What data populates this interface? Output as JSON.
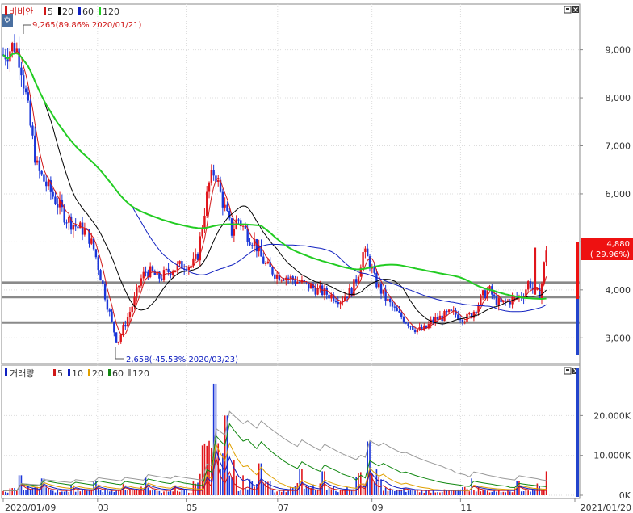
{
  "price_panel": {
    "stock_name": "비비안",
    "ma_legend": [
      {
        "label": "5",
        "color": "#d01818"
      },
      {
        "label": "20",
        "color": "#000000"
      },
      {
        "label": "60",
        "color": "#1020c0"
      },
      {
        "label": "120",
        "color": "#22cc22"
      }
    ],
    "high_annotation": "9,265(89.86% 2020/01/21)",
    "low_annotation": "2,658(-45.53% 2020/03/23)",
    "current_price": "4,880",
    "current_change": "( 29.96%)",
    "side_tab_label": "호"
  },
  "volume_panel": {
    "title": "거래량",
    "ma_legend": [
      {
        "label": "5",
        "color": "#d01818"
      },
      {
        "label": "10",
        "color": "#1020c0"
      },
      {
        "label": "20",
        "color": "#e0a000"
      },
      {
        "label": "60",
        "color": "#118811"
      },
      {
        "label": "120",
        "color": "#999999"
      }
    ]
  },
  "date_labels": [
    {
      "label": "2020/01/09",
      "t": 0
    },
    {
      "label": "03",
      "t": 0.165
    },
    {
      "label": "05",
      "t": 0.32
    },
    {
      "label": "07",
      "t": 0.48
    },
    {
      "label": "09",
      "t": 0.645
    },
    {
      "label": "11",
      "t": 0.8
    },
    {
      "label": "2021/01/20",
      "t": 1
    }
  ],
  "chart_data": [
    {
      "type": "candlestick",
      "title": "비비안",
      "y_ticks": [
        "9,000",
        "8,000",
        "7,000",
        "6,000",
        "5,000",
        "4,000",
        "3,000"
      ],
      "ylim": [
        2500,
        9700
      ],
      "x_range": [
        "2020/01/09",
        "2021/01/20"
      ],
      "horizontal_lines": [
        4150,
        3850,
        3320
      ],
      "price_path": [
        [
          0,
          8900
        ],
        [
          0.01,
          9000
        ],
        [
          0.02,
          9100
        ],
        [
          0.03,
          8800
        ],
        [
          0.04,
          8000
        ],
        [
          0.05,
          7200
        ],
        [
          0.06,
          6500
        ],
        [
          0.07,
          6300
        ],
        [
          0.08,
          6100
        ],
        [
          0.09,
          5900
        ],
        [
          0.1,
          5700
        ],
        [
          0.11,
          5500
        ],
        [
          0.12,
          5400
        ],
        [
          0.13,
          5300
        ],
        [
          0.14,
          5250
        ],
        [
          0.15,
          5100
        ],
        [
          0.16,
          4800
        ],
        [
          0.17,
          4300
        ],
        [
          0.18,
          3800
        ],
        [
          0.19,
          3300
        ],
        [
          0.2,
          2900
        ],
        [
          0.21,
          3200
        ],
        [
          0.22,
          3500
        ],
        [
          0.23,
          3800
        ],
        [
          0.24,
          4200
        ],
        [
          0.25,
          4400
        ],
        [
          0.26,
          4350
        ],
        [
          0.27,
          4250
        ],
        [
          0.28,
          4300
        ],
        [
          0.29,
          4400
        ],
        [
          0.3,
          4450
        ],
        [
          0.31,
          4500
        ],
        [
          0.32,
          4550
        ],
        [
          0.33,
          4500
        ],
        [
          0.34,
          4700
        ],
        [
          0.35,
          5500
        ],
        [
          0.36,
          6200
        ],
        [
          0.37,
          6500
        ],
        [
          0.38,
          6000
        ],
        [
          0.39,
          5600
        ],
        [
          0.4,
          5200
        ],
        [
          0.41,
          5500
        ],
        [
          0.42,
          5300
        ],
        [
          0.43,
          5100
        ],
        [
          0.44,
          5000
        ],
        [
          0.45,
          4700
        ],
        [
          0.46,
          4500
        ],
        [
          0.47,
          4400
        ],
        [
          0.48,
          4300
        ],
        [
          0.49,
          4300
        ],
        [
          0.5,
          4250
        ],
        [
          0.51,
          4200
        ],
        [
          0.52,
          4150
        ],
        [
          0.53,
          4100
        ],
        [
          0.54,
          4050
        ],
        [
          0.55,
          4000
        ],
        [
          0.56,
          3950
        ],
        [
          0.57,
          3900
        ],
        [
          0.58,
          3850
        ],
        [
          0.59,
          3800
        ],
        [
          0.6,
          3900
        ],
        [
          0.61,
          4000
        ],
        [
          0.62,
          4300
        ],
        [
          0.63,
          4800
        ],
        [
          0.64,
          4600
        ],
        [
          0.65,
          4200
        ],
        [
          0.66,
          4000
        ],
        [
          0.67,
          3800
        ],
        [
          0.68,
          3650
        ],
        [
          0.69,
          3500
        ],
        [
          0.7,
          3400
        ],
        [
          0.71,
          3300
        ],
        [
          0.72,
          3200
        ],
        [
          0.73,
          3150
        ],
        [
          0.74,
          3200
        ],
        [
          0.75,
          3350
        ],
        [
          0.76,
          3400
        ],
        [
          0.77,
          3450
        ],
        [
          0.78,
          3500
        ],
        [
          0.79,
          3500
        ],
        [
          0.8,
          3450
        ],
        [
          0.81,
          3400
        ],
        [
          0.82,
          3500
        ],
        [
          0.83,
          3700
        ],
        [
          0.84,
          3900
        ],
        [
          0.85,
          4000
        ],
        [
          0.86,
          3800
        ],
        [
          0.87,
          3700
        ],
        [
          0.88,
          3750
        ],
        [
          0.89,
          3800
        ],
        [
          0.9,
          3850
        ],
        [
          0.91,
          3900
        ],
        [
          0.92,
          4200
        ],
        [
          0.93,
          3900
        ],
        [
          0.94,
          3950
        ],
        [
          0.95,
          4880
        ]
      ],
      "series": [
        {
          "name": "5",
          "color": "#d01818"
        },
        {
          "name": "20",
          "color": "#000000"
        },
        {
          "name": "60",
          "color": "#1020c0"
        },
        {
          "name": "120",
          "color": "#22cc22"
        }
      ]
    },
    {
      "type": "bar",
      "title": "거래량",
      "y_ticks": [
        "20,000K",
        "10,000K",
        "0K"
      ],
      "ylim": [
        0,
        29000
      ],
      "volume_spikes": [
        [
          0.03,
          5000
        ],
        [
          0.07,
          4200
        ],
        [
          0.12,
          2500
        ],
        [
          0.16,
          3500
        ],
        [
          0.21,
          2800
        ],
        [
          0.25,
          4500
        ],
        [
          0.3,
          2300
        ],
        [
          0.35,
          12500
        ],
        [
          0.37,
          28000
        ],
        [
          0.39,
          20000
        ],
        [
          0.42,
          5000
        ],
        [
          0.45,
          8000
        ],
        [
          0.52,
          6500
        ],
        [
          0.56,
          6000
        ],
        [
          0.62,
          4500
        ],
        [
          0.64,
          13500
        ],
        [
          0.66,
          4000
        ],
        [
          0.7,
          1800
        ],
        [
          0.82,
          4200
        ],
        [
          0.9,
          3500
        ],
        [
          0.95,
          6000
        ]
      ],
      "series": [
        {
          "name": "5",
          "color": "#d01818"
        },
        {
          "name": "10",
          "color": "#1020c0"
        },
        {
          "name": "20",
          "color": "#e0a000"
        },
        {
          "name": "60",
          "color": "#118811"
        },
        {
          "name": "120",
          "color": "#999999"
        }
      ]
    }
  ]
}
